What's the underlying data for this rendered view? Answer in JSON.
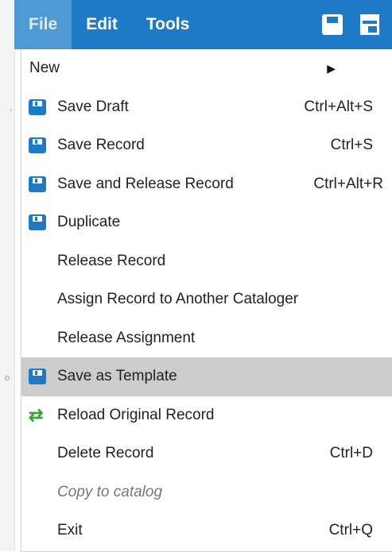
{
  "menubar": {
    "file_label": "File",
    "edit_label": "Edit",
    "tools_label": "Tools"
  },
  "menu": {
    "items": [
      {
        "label": "New",
        "shortcut": "",
        "icon": "",
        "submenu": true
      },
      {
        "label": "Save Draft",
        "shortcut": "Ctrl+Alt+S",
        "icon": "save-icon"
      },
      {
        "label": "Save Record",
        "shortcut": "Ctrl+S",
        "icon": "save-icon"
      },
      {
        "label": "Save and Release Record",
        "shortcut": "Ctrl+Alt+R",
        "icon": "save-icon"
      },
      {
        "label": "Duplicate",
        "shortcut": "",
        "icon": "save-icon"
      },
      {
        "label": "Release Record",
        "shortcut": ""
      },
      {
        "label": "Assign Record to Another Cataloger",
        "shortcut": ""
      },
      {
        "label": "Release Assignment",
        "shortcut": ""
      },
      {
        "label": "Save as Template",
        "shortcut": "",
        "icon": "save-icon",
        "highlighted": true
      },
      {
        "label": "Reload Original Record",
        "shortcut": "",
        "icon": "reload-icon"
      },
      {
        "label": "Delete Record",
        "shortcut": "Ctrl+D"
      },
      {
        "label": "Copy to catalog",
        "shortcut": "",
        "disabled": true
      },
      {
        "label": "Exit",
        "shortcut": "Ctrl+Q"
      }
    ]
  },
  "colors": {
    "menubar_bg": "#1f7ac5",
    "active_tab_bg": "#4f9ad5",
    "highlight_bg": "#cccccc",
    "save_icon": "#1f7ac5",
    "reload_icon": "#3ca03c"
  }
}
